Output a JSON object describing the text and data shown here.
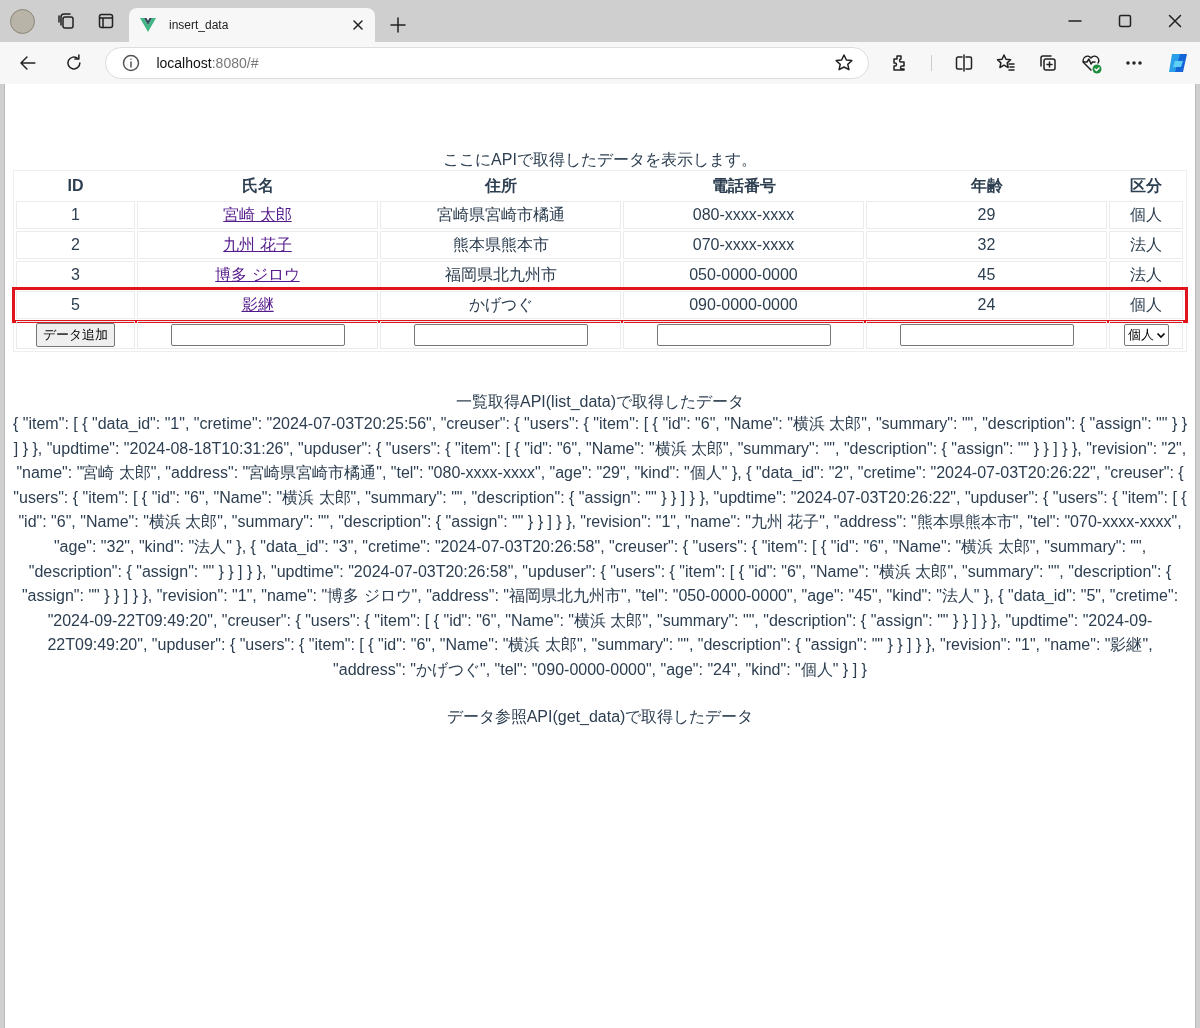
{
  "browser": {
    "tab": {
      "title": "insert_data",
      "selected": true
    },
    "url": {
      "host": "localhost",
      "rest": ":8080/#"
    }
  },
  "page": {
    "table_caption": "ここにAPIで取得したデータを表示します。",
    "table": {
      "columns": [
        "ID",
        "氏名",
        "住所",
        "電話番号",
        "年齢",
        "区分"
      ],
      "rows": [
        {
          "cells": [
            "1",
            "宮崎 太郎",
            "宮崎県宮崎市橘通",
            "080-xxxx-xxxx",
            "29",
            "個人"
          ],
          "highlighted": false
        },
        {
          "cells": [
            "2",
            "九州 花子",
            "熊本県熊本市",
            "070-xxxx-xxxx",
            "32",
            "法人"
          ],
          "highlighted": false
        },
        {
          "cells": [
            "3",
            "博多 ジロウ",
            "福岡県北九州市",
            "050-0000-0000",
            "45",
            "法人"
          ],
          "highlighted": false
        },
        {
          "cells": [
            "5",
            "影継",
            "かげつぐ",
            "090-0000-0000",
            "24",
            "個人"
          ],
          "highlighted": true
        }
      ],
      "form": {
        "button": "データ追加",
        "fields": [
          {
            "kind": "text"
          },
          {
            "kind": "text"
          },
          {
            "kind": "text"
          },
          {
            "kind": "text"
          },
          {
            "kind": "select",
            "value": "個人"
          }
        ]
      }
    },
    "list_caption": "一覧取得API(list_data)で取得したデータ",
    "list_dump": "{ \"item\": [ { \"data_id\": \"1\", \"cretime\": \"2024-07-03T20:25:56\", \"creuser\": { \"users\": { \"item\": [ { \"id\": \"6\", \"Name\": \"横浜 太郎\", \"summary\": \"\", \"description\": { \"assign\": \"\" } } ] } }, \"updtime\": \"2024-08-18T10:31:26\", \"upduser\": { \"users\": { \"item\": [ { \"id\": \"6\", \"Name\": \"横浜 太郎\", \"summary\": \"\", \"description\": { \"assign\": \"\" } } ] } }, \"revision\": \"2\", \"name\": \"宮崎 太郎\", \"address\": \"宮崎県宮崎市橘通\", \"tel\": \"080-xxxx-xxxx\", \"age\": \"29\", \"kind\": \"個人\" }, { \"data_id\": \"2\", \"cretime\": \"2024-07-03T20:26:22\", \"creuser\": { \"users\": { \"item\": [ { \"id\": \"6\", \"Name\": \"横浜 太郎\", \"summary\": \"\", \"description\": { \"assign\": \"\" } } ] } }, \"updtime\": \"2024-07-03T20:26:22\", \"upduser\": { \"users\": { \"item\": [ { \"id\": \"6\", \"Name\": \"横浜 太郎\", \"summary\": \"\", \"description\": { \"assign\": \"\" } } ] } }, \"revision\": \"1\", \"name\": \"九州 花子\", \"address\": \"熊本県熊本市\", \"tel\": \"070-xxxx-xxxx\", \"age\": \"32\", \"kind\": \"法人\" }, { \"data_id\": \"3\", \"cretime\": \"2024-07-03T20:26:58\", \"creuser\": { \"users\": { \"item\": [ { \"id\": \"6\", \"Name\": \"横浜 太郎\", \"summary\": \"\", \"description\": { \"assign\": \"\" } } ] } }, \"updtime\": \"2024-07-03T20:26:58\", \"upduser\": { \"users\": { \"item\": [ { \"id\": \"6\", \"Name\": \"横浜 太郎\", \"summary\": \"\", \"description\": { \"assign\": \"\" } } ] } }, \"revision\": \"1\", \"name\": \"博多 ジロウ\", \"address\": \"福岡県北九州市\", \"tel\": \"050-0000-0000\", \"age\": \"45\", \"kind\": \"法人\" }, { \"data_id\": \"5\", \"cretime\": \"2024-09-22T09:49:20\", \"creuser\": { \"users\": { \"item\": [ { \"id\": \"6\", \"Name\": \"横浜 太郎\", \"summary\": \"\", \"description\": { \"assign\": \"\" } } ] } }, \"updtime\": \"2024-09-22T09:49:20\", \"upduser\": { \"users\": { \"item\": [ { \"id\": \"6\", \"Name\": \"横浜 太郎\", \"summary\": \"\", \"description\": { \"assign\": \"\" } } ] } }, \"revision\": \"1\", \"name\": \"影継\", \"address\": \"かげつぐ\", \"tel\": \"090-0000-0000\", \"age\": \"24\", \"kind\": \"個人\" } ] }",
    "get_caption": "データ参照API(get_data)で取得したデータ"
  }
}
